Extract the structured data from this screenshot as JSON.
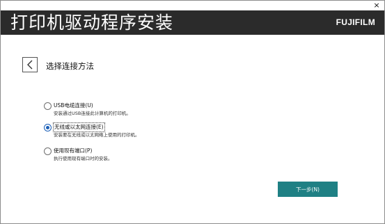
{
  "window": {
    "close_glyph": "×"
  },
  "header": {
    "title": "打印机驱动程序安装",
    "brand": "FUJIFILM",
    "background": "#2b2b2b"
  },
  "page": {
    "back_icon": "chevron-left-icon",
    "section_title": "选择连接方法"
  },
  "options": [
    {
      "label": "USB电缆连接(U)",
      "description": "安装通过USB连接此计算机的打印机。",
      "selected": false
    },
    {
      "label": "无线或以太网连接(E)",
      "description": "安装要在无线或以太网络上使用的打印机。",
      "selected": true
    },
    {
      "label": "使用现有端口(P)",
      "description": "执行使用现有端口时的安装。",
      "selected": false
    }
  ],
  "footer": {
    "next_label": "下一步(N)",
    "accent": "#1f8084"
  }
}
